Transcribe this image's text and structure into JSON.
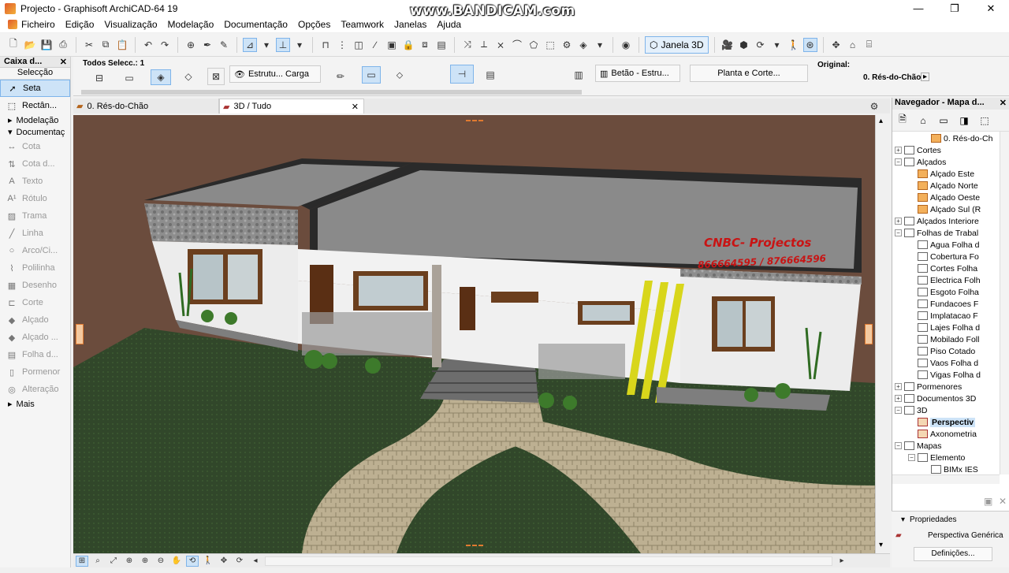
{
  "window": {
    "title": "Projecto - Graphisoft ArchiCAD-64 19",
    "watermark": "www.BANDICAM.com",
    "controls": [
      "—",
      "❐",
      "✕"
    ]
  },
  "menu": [
    "Ficheiro",
    "Edição",
    "Visualização",
    "Modelação",
    "Documentação",
    "Opções",
    "Teamwork",
    "Janelas",
    "Ajuda"
  ],
  "toolbar": {
    "window3d_label": "Janela 3D"
  },
  "toolbox": {
    "title": "Caixa d...",
    "selection_header": "Selecção",
    "tools": [
      {
        "label": "Seta",
        "icon": "arrow-icon",
        "active": true
      },
      {
        "label": "Rectân...",
        "icon": "marquee-icon",
        "active": false
      }
    ],
    "groups": [
      {
        "label": "Modelação",
        "expanded": false
      },
      {
        "label": "Documentaç",
        "expanded": true
      }
    ],
    "doc_tools": [
      "Cota",
      "Cota d...",
      "Texto",
      "Rótulo",
      "Trama",
      "Linha",
      "Arco/Ci...",
      "Polilinha",
      "Desenho",
      "Corte",
      "Alçado",
      "Alçado ...",
      "Folha d...",
      "Pormenor",
      "Alteração"
    ],
    "more": "Mais"
  },
  "infobox": {
    "selection_label": "Todos Selecc.: 1",
    "structure_button": "Estrutu... Carga",
    "material_button": "Betão - Estru...",
    "plan_section_button": "Planta e Corte...",
    "original_label": "Original:",
    "original_value": "0. Rés-do-Chão"
  },
  "tabs": [
    {
      "label": "0. Rés-do-Chão",
      "active": false
    },
    {
      "label": "3D / Tudo",
      "active": true
    }
  ],
  "viewport": {
    "sign_title": "CNBC- Projectos",
    "sign_phone": "866664595 / 876664596"
  },
  "navigator": {
    "title": "Navegador - Mapa d...",
    "items": [
      {
        "label": "0. Rés-do-Ch",
        "level": 3,
        "icon": "house",
        "toggle": ""
      },
      {
        "label": "Cortes",
        "level": 1,
        "icon": "folder",
        "toggle": "+"
      },
      {
        "label": "Alçados",
        "level": 1,
        "icon": "folder",
        "toggle": "−"
      },
      {
        "label": "Alçado Este",
        "level": 2,
        "icon": "house",
        "toggle": ""
      },
      {
        "label": "Alçado Norte",
        "level": 2,
        "icon": "house",
        "toggle": ""
      },
      {
        "label": "Alçado Oeste",
        "level": 2,
        "icon": "house",
        "toggle": ""
      },
      {
        "label": "Alçado Sul (R",
        "level": 2,
        "icon": "house",
        "toggle": ""
      },
      {
        "label": "Alçados Interiore",
        "level": 1,
        "icon": "folder",
        "toggle": "+"
      },
      {
        "label": "Folhas de Trabal",
        "level": 1,
        "icon": "folder",
        "toggle": "−"
      },
      {
        "label": "Agua Folha d",
        "level": 2,
        "icon": "sheet",
        "toggle": ""
      },
      {
        "label": "Cobertura Fo",
        "level": 2,
        "icon": "sheet",
        "toggle": ""
      },
      {
        "label": "Cortes Folha",
        "level": 2,
        "icon": "sheet",
        "toggle": ""
      },
      {
        "label": "Electrica Folh",
        "level": 2,
        "icon": "sheet",
        "toggle": ""
      },
      {
        "label": "Esgoto Folha",
        "level": 2,
        "icon": "sheet",
        "toggle": ""
      },
      {
        "label": "Fundacoes F",
        "level": 2,
        "icon": "sheet",
        "toggle": ""
      },
      {
        "label": "Implatacao F",
        "level": 2,
        "icon": "sheet",
        "toggle": ""
      },
      {
        "label": "Lajes Folha d",
        "level": 2,
        "icon": "sheet",
        "toggle": ""
      },
      {
        "label": "Mobilado Foll",
        "level": 2,
        "icon": "sheet",
        "toggle": ""
      },
      {
        "label": "Piso Cotado",
        "level": 2,
        "icon": "sheet",
        "toggle": ""
      },
      {
        "label": "Vaos Folha d",
        "level": 2,
        "icon": "sheet",
        "toggle": ""
      },
      {
        "label": "Vigas Folha d",
        "level": 2,
        "icon": "sheet",
        "toggle": ""
      },
      {
        "label": "Pormenores",
        "level": 1,
        "icon": "folder",
        "toggle": "+"
      },
      {
        "label": "Documentos 3D",
        "level": 1,
        "icon": "folder",
        "toggle": "+"
      },
      {
        "label": "3D",
        "level": 1,
        "icon": "folder",
        "toggle": "−"
      },
      {
        "label": "Perspectiv",
        "level": 2,
        "icon": "persp",
        "toggle": "",
        "selected": true
      },
      {
        "label": "Axonometria",
        "level": 2,
        "icon": "persp",
        "toggle": ""
      },
      {
        "label": "Mapas",
        "level": 1,
        "icon": "folder",
        "toggle": "−"
      },
      {
        "label": "Elemento",
        "level": 2,
        "icon": "folder",
        "toggle": "−"
      },
      {
        "label": "BIMx IES",
        "level": 3,
        "icon": "sheet",
        "toggle": ""
      }
    ],
    "properties_label": "Propriedades",
    "properties_value": "Perspectiva Genérica",
    "definitions_button": "Definições..."
  }
}
